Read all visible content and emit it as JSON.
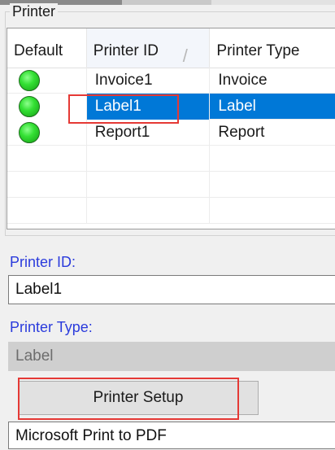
{
  "printer_group": {
    "title": "Printer"
  },
  "grid": {
    "columns": [
      "Default",
      "Printer ID",
      "Printer Type"
    ],
    "sort_indicator": "/",
    "rows": [
      {
        "status_icon": "green-status-dot",
        "printer_id": "Invoice1",
        "printer_type": "Invoice",
        "selected": false
      },
      {
        "status_icon": "green-status-dot",
        "printer_id": "Label1",
        "printer_type": "Label",
        "selected": true
      },
      {
        "status_icon": "green-status-dot",
        "printer_id": "Report1",
        "printer_type": "Report",
        "selected": false
      }
    ]
  },
  "form": {
    "printer_id_label": "Printer ID:",
    "printer_id_value": "Label1",
    "printer_type_label": "Printer Type:",
    "printer_type_value": "Label",
    "setup_button_label": "Printer Setup",
    "printer_name_value": "Microsoft Print to PDF"
  },
  "colors": {
    "selection": "#0078d7",
    "highlight_box": "#e53935",
    "label_text": "#2a3bdc",
    "status_green": "#34e034"
  }
}
